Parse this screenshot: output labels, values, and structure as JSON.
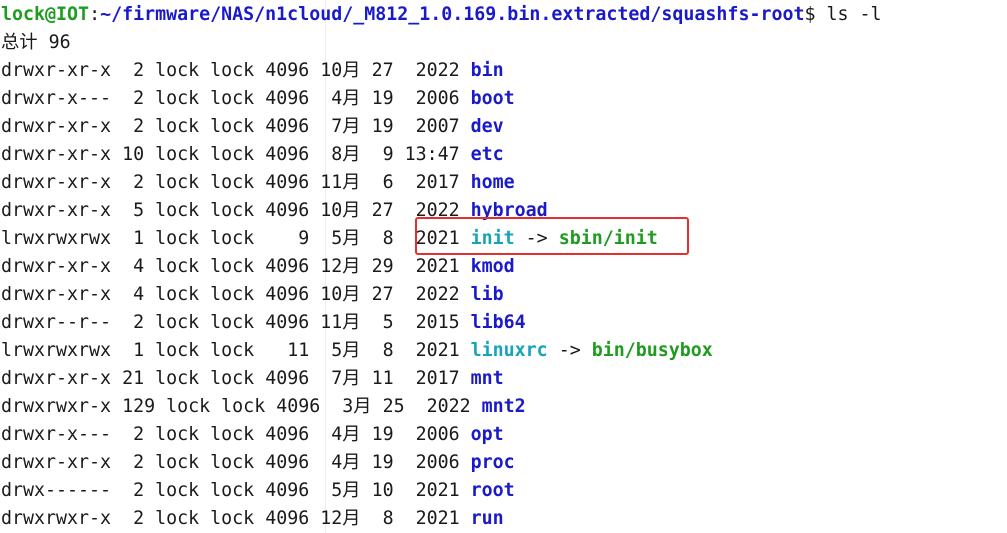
{
  "prompt": {
    "user": "lock@IOT",
    "separator": ":",
    "path": "~/firmware/NAS/n1cloud/_M812_1.0.169.bin.extracted/squashfs-root",
    "symbol": "$",
    "command": " ls -l"
  },
  "total_line": "总计 96",
  "entries": [
    {
      "perms": "drwxr-xr-x  ",
      "links": "2",
      "owner": "lock",
      "group": "lock",
      "size": "4096",
      "month": "10月",
      "day": "27",
      "time": " 2022",
      "name": "bin",
      "kind": "dir",
      "target": ""
    },
    {
      "perms": "drwxr-x---  ",
      "links": "2",
      "owner": "lock",
      "group": "lock",
      "size": "4096",
      "month": " 4月",
      "day": "19",
      "time": " 2006",
      "name": "boot",
      "kind": "dir",
      "target": ""
    },
    {
      "perms": "drwxr-xr-x  ",
      "links": "2",
      "owner": "lock",
      "group": "lock",
      "size": "4096",
      "month": " 7月",
      "day": "19",
      "time": " 2007",
      "name": "dev",
      "kind": "dir",
      "target": ""
    },
    {
      "perms": "drwxr-xr-x ",
      "links": "10",
      "owner": "lock",
      "group": "lock",
      "size": "4096",
      "month": " 8月",
      "day": " 9",
      "time": "13:47",
      "name": "etc",
      "kind": "dir",
      "target": ""
    },
    {
      "perms": "drwxr-xr-x  ",
      "links": "2",
      "owner": "lock",
      "group": "lock",
      "size": "4096",
      "month": "11月",
      "day": " 6",
      "time": " 2017",
      "name": "home",
      "kind": "dir",
      "target": ""
    },
    {
      "perms": "drwxr-xr-x  ",
      "links": "5",
      "owner": "lock",
      "group": "lock",
      "size": "4096",
      "month": "10月",
      "day": "27",
      "time": " 2022",
      "name": "hybroad",
      "kind": "dir",
      "target": ""
    },
    {
      "perms": "lrwxrwxrwx  ",
      "links": "1",
      "owner": "lock",
      "group": "lock",
      "size": "   9",
      "month": " 5月",
      "day": " 8",
      "time": " 2021",
      "name": "init",
      "kind": "link",
      "target": "sbin/init"
    },
    {
      "perms": "drwxr-xr-x  ",
      "links": "4",
      "owner": "lock",
      "group": "lock",
      "size": "4096",
      "month": "12月",
      "day": "29",
      "time": " 2021",
      "name": "kmod",
      "kind": "dir",
      "target": ""
    },
    {
      "perms": "drwxr-xr-x  ",
      "links": "4",
      "owner": "lock",
      "group": "lock",
      "size": "4096",
      "month": "10月",
      "day": "27",
      "time": " 2022",
      "name": "lib",
      "kind": "dir",
      "target": ""
    },
    {
      "perms": "drwxr--r--  ",
      "links": "2",
      "owner": "lock",
      "group": "lock",
      "size": "4096",
      "month": "11月",
      "day": " 5",
      "time": " 2015",
      "name": "lib64",
      "kind": "dir",
      "target": ""
    },
    {
      "perms": "lrwxrwxrwx  ",
      "links": "1",
      "owner": "lock",
      "group": "lock",
      "size": "  11",
      "month": " 5月",
      "day": " 8",
      "time": " 2021",
      "name": "linuxrc",
      "kind": "link",
      "target": "bin/busybox"
    },
    {
      "perms": "drwxr-xr-x ",
      "links": "21",
      "owner": "lock",
      "group": "lock",
      "size": "4096",
      "month": " 7月",
      "day": "11",
      "time": " 2017",
      "name": "mnt",
      "kind": "dir",
      "target": ""
    },
    {
      "perms": "drwxrwxr-x ",
      "links": "129",
      "owner": "lock",
      "group": "lock",
      "size": "4096",
      "month": " 3月",
      "day": "25",
      "time": " 2022",
      "name": "mnt2",
      "kind": "dir",
      "target": ""
    },
    {
      "perms": "drwxr-x---  ",
      "links": "2",
      "owner": "lock",
      "group": "lock",
      "size": "4096",
      "month": " 4月",
      "day": "19",
      "time": " 2006",
      "name": "opt",
      "kind": "dir",
      "target": ""
    },
    {
      "perms": "drwxr-xr-x  ",
      "links": "2",
      "owner": "lock",
      "group": "lock",
      "size": "4096",
      "month": " 4月",
      "day": "19",
      "time": " 2006",
      "name": "proc",
      "kind": "dir",
      "target": ""
    },
    {
      "perms": "drwx------  ",
      "links": "2",
      "owner": "lock",
      "group": "lock",
      "size": "4096",
      "month": " 5月",
      "day": "10",
      "time": " 2021",
      "name": "root",
      "kind": "dir",
      "target": ""
    },
    {
      "perms": "drwxrwxr-x  ",
      "links": "2",
      "owner": "lock",
      "group": "lock",
      "size": "4096",
      "month": "12月",
      "day": " 8",
      "time": " 2021",
      "name": "run",
      "kind": "dir",
      "target": ""
    }
  ],
  "arrow": " -> ",
  "colors": {
    "prompt_user": "#1e9c1e",
    "prompt_path": "#1a1ac8",
    "directory": "#1a1ac8",
    "symlink": "#16a5b8",
    "link_target": "#1e9c1e",
    "highlight": "#e03030"
  }
}
